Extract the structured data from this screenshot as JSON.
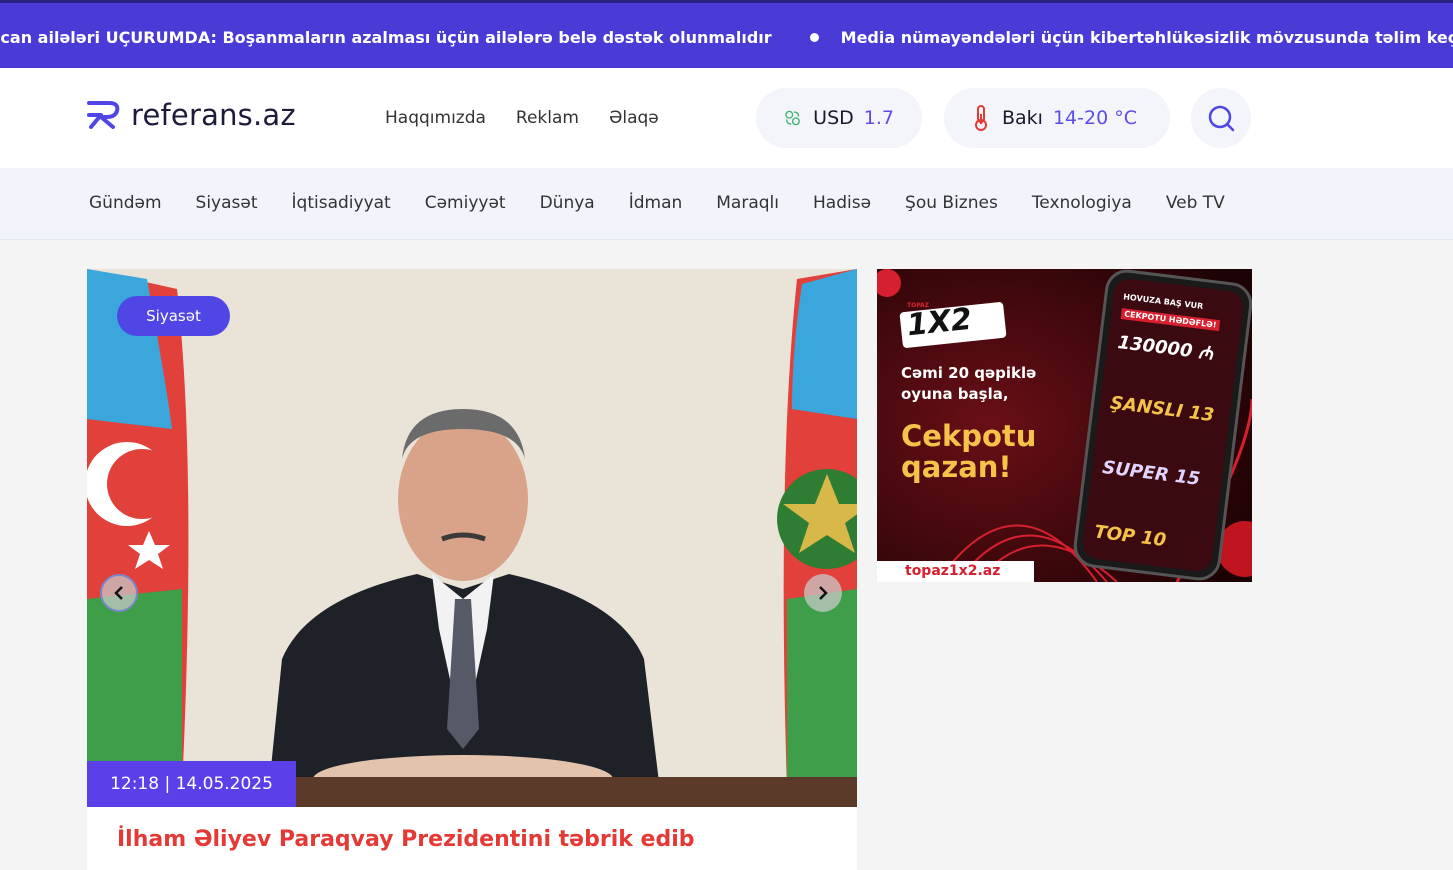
{
  "ticker": {
    "items": [
      "ycan ailələri UÇURUMDA: Boşanmaların azalması üçün ailələrə belə dəstək olunmalıdır",
      "Media nümayəndələri üçün kibertəhlükəsizlik mövzusunda təlim keçirildi – FOTOLAR"
    ]
  },
  "header": {
    "logo_text": "referans.az",
    "nav": [
      "Haqqımızda",
      "Reklam",
      "Əlaqə"
    ],
    "currency": {
      "label": "USD",
      "value": "1.7"
    },
    "weather": {
      "city": "Bakı",
      "temp": "14-20 °C"
    }
  },
  "categories": [
    "Gündəm",
    "Siyasət",
    "İqtisadiyyat",
    "Cəmiyyət",
    "Dünya",
    "İdman",
    "Maraqlı",
    "Hadisə",
    "Şou Biznes",
    "Texnologiya",
    "Veb TV"
  ],
  "hero": {
    "badge": "Siyasət",
    "time": "12:18  |  14.05.2025",
    "title": "İlham Əliyev Paraqvay Prezidentini təbrik edib"
  },
  "ad": {
    "brand": "1X2",
    "brand_small": "TOPAZ",
    "line1": "Cəmi 20 qəpiklə oyuna başla,",
    "line2": "Cekpotu qazan!",
    "url": "topaz1x2.az",
    "phone_header": "HOVUZA BAŞ VUR",
    "phone_badge": "CEKPOTU HƏDƏFLƏ!",
    "jackpot": "130000 ₼",
    "game1": "ŞANSLI 13",
    "game2": "SUPER 15",
    "game3": "TOP 10"
  },
  "colors": {
    "ticker": "#4a3bd6",
    "accent": "#5b3fe8",
    "title": "#e53935"
  }
}
